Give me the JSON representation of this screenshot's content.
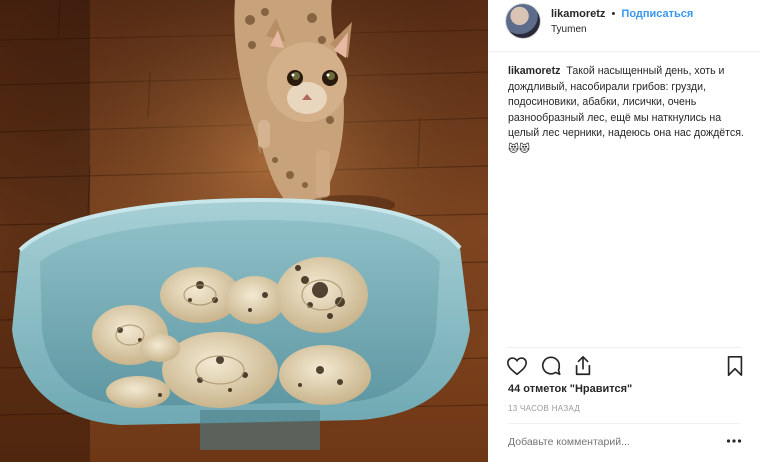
{
  "post": {
    "username": "likamoretz",
    "separator": "•",
    "follow_label": "Подписаться",
    "location": "Tyumen",
    "caption_text": "Такой насыщенный день, хоть и дождливый, насобирали грибов: грузди, подосиновики, абабки, лисички, очень разнообразный лес, ещё мы наткнулись на целый лес черники, надеюсь она нас дождётся. 😻😻",
    "likes": "44 отметок \"Нравится\"",
    "timestamp": "13 часов назад",
    "comment_placeholder": "Добавьте комментарий..."
  },
  "icons": {
    "like": "heart-icon",
    "comment": "comment-bubble-icon",
    "share": "share-icon",
    "save": "bookmark-icon",
    "more": "more-options-icon"
  },
  "colors": {
    "follow": "#3897f0",
    "text": "#262626",
    "muted": "#999999",
    "divider": "#efefef"
  }
}
